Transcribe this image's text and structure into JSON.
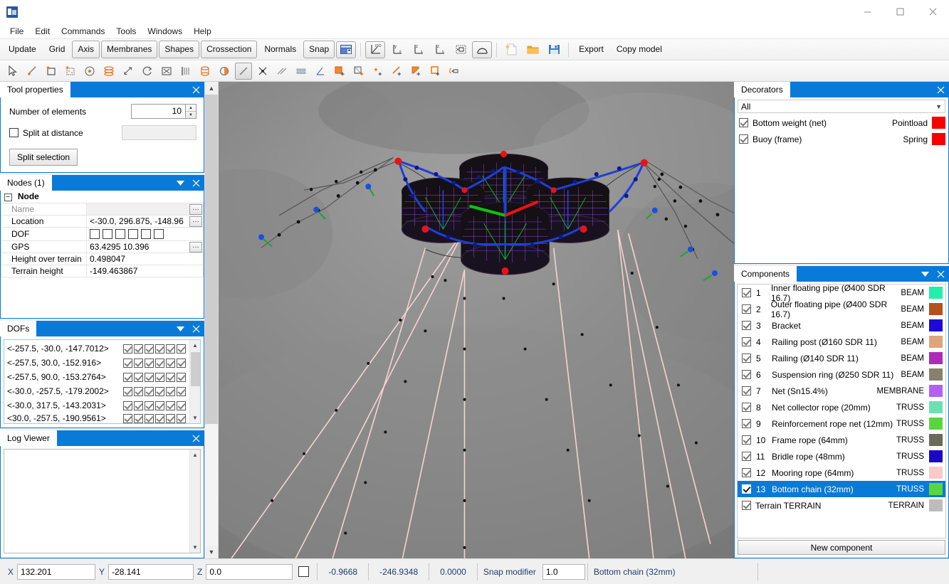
{
  "window": {
    "icon": "app-icon",
    "minimize": "minimize-icon",
    "maximize": "maximize-icon",
    "close": "close-icon"
  },
  "menu": {
    "items": [
      "File",
      "Edit",
      "Commands",
      "Tools",
      "Windows",
      "Help"
    ]
  },
  "toolbar1": {
    "buttons": [
      {
        "label": "Update",
        "framed": false
      },
      {
        "label": "Grid",
        "framed": false
      },
      {
        "label": "Axis",
        "framed": true
      },
      {
        "label": "Membranes",
        "framed": true
      },
      {
        "label": "Shapes",
        "framed": true
      },
      {
        "label": "Crossection",
        "framed": true
      },
      {
        "label": "Normals",
        "framed": false
      },
      {
        "label": "Snap",
        "framed": true
      }
    ],
    "icons": [
      "lock-view-icon",
      "iso-view-icon",
      "front-view-icon",
      "side-view-icon",
      "top-view-icon",
      "zoom-extents-icon",
      "shape-view-icon",
      "new-file-icon",
      "open-folder-icon",
      "save-disk-icon"
    ],
    "export_label": "Export",
    "copy_model_label": "Copy model"
  },
  "toolbar2": {
    "icons": [
      "select-arrow-icon",
      "add-line-icon",
      "add-rect-icon",
      "add-mesh-icon",
      "add-point-icon",
      "extrude-icon",
      "scale-icon",
      "rotate-icon",
      "fit-icon",
      "array-icon",
      "cylinder-icon",
      "half-circle-icon",
      "line-tool-icon",
      "intersect-icon",
      "parallel-icon",
      "offset-icon",
      "angle-icon",
      "fill-square-icon",
      "square-corner-icon",
      "add-node-icon",
      "add-edge-icon",
      "add-face-icon",
      "add-surface-icon",
      "measure-icon"
    ]
  },
  "tool_properties": {
    "title": "Tool properties",
    "number_of_elements_label": "Number of elements",
    "number_of_elements_value": "10",
    "split_at_distance_label": "Split at distance",
    "split_at_distance_checked": false,
    "split_at_distance_value": "",
    "split_selection_label": "Split selection"
  },
  "nodes": {
    "title": "Nodes (1)",
    "category": "Node",
    "rows": [
      {
        "key": "Name",
        "value": "",
        "greyed": true,
        "ellipsis": true
      },
      {
        "key": "Location",
        "value": "<-30.0, 296.875, -148.96",
        "greyed": false,
        "ellipsis": true
      },
      {
        "key": "DOF",
        "value": "",
        "greyed": false,
        "ellipsis": false,
        "dof_count": 6
      },
      {
        "key": "GPS",
        "value": "63.4295  10.396",
        "greyed": false,
        "ellipsis": true
      },
      {
        "key": "Height over terrain",
        "value": "0.498047",
        "greyed": false,
        "ellipsis": false
      },
      {
        "key": "Terrain height",
        "value": "-149.463867",
        "greyed": false,
        "ellipsis": false
      }
    ]
  },
  "dofs": {
    "title": "DOFs",
    "rows": [
      {
        "coord": "<-257.5, -30.0, -147.7012>",
        "checks": [
          true,
          true,
          true,
          true,
          true,
          true
        ]
      },
      {
        "coord": "<-257.5, 30.0, -152.916>",
        "checks": [
          true,
          true,
          true,
          true,
          true,
          true
        ]
      },
      {
        "coord": "<-257.5, 90.0, -153.2764>",
        "checks": [
          true,
          true,
          true,
          true,
          true,
          true
        ]
      },
      {
        "coord": "<-30.0, -257.5, -179.2002>",
        "checks": [
          true,
          true,
          true,
          true,
          true,
          true
        ]
      },
      {
        "coord": "<-30.0, 317.5, -143.2031>",
        "checks": [
          true,
          true,
          true,
          true,
          true,
          true
        ]
      },
      {
        "coord": "<30.0, -257.5, -190.9561>",
        "checks": [
          true,
          true,
          true,
          true,
          true,
          true
        ]
      }
    ]
  },
  "log_viewer": {
    "title": "Log Viewer",
    "content": ""
  },
  "decorators": {
    "title": "Decorators",
    "filter_value": "All",
    "items": [
      {
        "checked": true,
        "name": "Bottom weight (net)",
        "type": "Pointload",
        "color": "#f90000"
      },
      {
        "checked": true,
        "name": "Buoy (frame)",
        "type": "Spring",
        "color": "#f90000"
      }
    ]
  },
  "components": {
    "title": "Components",
    "new_component_label": "New component",
    "items": [
      {
        "checked": true,
        "num": "1",
        "name": "Inner floating pipe (Ø400 SDR 16.7)",
        "type": "BEAM",
        "color": "#22efaa",
        "selected": false
      },
      {
        "checked": true,
        "num": "2",
        "name": "Outer floating pipe (Ø400 SDR 16.7)",
        "type": "BEAM",
        "color": "#b4511a",
        "selected": false
      },
      {
        "checked": true,
        "num": "3",
        "name": "Bracket",
        "type": "BEAM",
        "color": "#1c08d8",
        "selected": false
      },
      {
        "checked": true,
        "num": "4",
        "name": "Railing post (Ø160 SDR 11)",
        "type": "BEAM",
        "color": "#dda579",
        "selected": false
      },
      {
        "checked": true,
        "num": "5",
        "name": "Railing (Ø140 SDR 11)",
        "type": "BEAM",
        "color": "#ad2bb8",
        "selected": false
      },
      {
        "checked": true,
        "num": "6",
        "name": "Suspension ring (Ø250 SDR 11)",
        "type": "BEAM",
        "color": "#87806a",
        "selected": false
      },
      {
        "checked": true,
        "num": "7",
        "name": "Net (Sn15.4%)",
        "type": "MEMBRANE",
        "color": "#b360f0",
        "selected": false
      },
      {
        "checked": true,
        "num": "8",
        "name": "Net collector rope (20mm)",
        "type": "TRUSS",
        "color": "#6ce0b2",
        "selected": false
      },
      {
        "checked": true,
        "num": "9",
        "name": "Reinforcement rope net (12mm)",
        "type": "TRUSS",
        "color": "#58d63f",
        "selected": false
      },
      {
        "checked": true,
        "num": "10",
        "name": "Frame rope (64mm)",
        "type": "TRUSS",
        "color": "#6a6a58",
        "selected": false
      },
      {
        "checked": true,
        "num": "11",
        "name": "Bridle rope (48mm)",
        "type": "TRUSS",
        "color": "#1a08c8",
        "selected": false
      },
      {
        "checked": true,
        "num": "12",
        "name": "Mooring rope (64mm)",
        "type": "TRUSS",
        "color": "#fac9c9",
        "selected": false
      },
      {
        "checked": true,
        "num": "13",
        "name": "Bottom chain (32mm)",
        "type": "TRUSS",
        "color": "#58d63f",
        "selected": true
      },
      {
        "checked": true,
        "num": "",
        "name": "Terrain TERRAIN",
        "type": "TERRAIN",
        "color": "#bcbcbc",
        "selected": false
      }
    ]
  },
  "statusbar": {
    "x_label": "X",
    "x_value": "132.201",
    "y_label": "Y",
    "y_value": "-28.141",
    "z_label": "Z",
    "z_value": "0.0",
    "checkbox_checked": false,
    "num1": "-0.9668",
    "num2": "-246.9348",
    "num3": "0.0000",
    "snap_modifier_label": "Snap modifier",
    "snap_modifier_value": "1.0",
    "active_component": "Bottom chain (32mm)"
  },
  "viewport": {
    "name": "3d-model-viewport",
    "description": "3D fish farm net pen model with mooring lines over terrain"
  },
  "colors": {
    "panel_title_bg": "#0a7ad8",
    "selection": "#0a7ad8",
    "accent_orange": "#e8731b",
    "status_text": "#1f3c6e"
  }
}
